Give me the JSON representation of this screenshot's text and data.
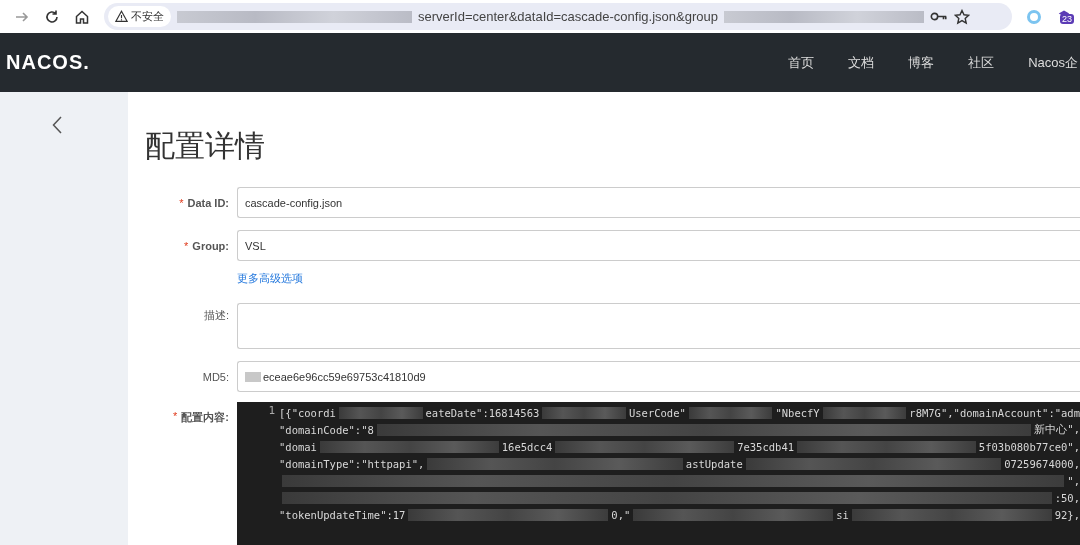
{
  "browser": {
    "security": "不安全",
    "url_parts": [
      {
        "kind": "blur"
      },
      {
        "kind": "text",
        "text": "serverId=center&dataId=cascade-config.json&group"
      },
      {
        "kind": "blur"
      }
    ],
    "badge": "23"
  },
  "header": {
    "logo": "NACOS.",
    "nav": [
      {
        "label": "首页"
      },
      {
        "label": "文档"
      },
      {
        "label": "博客"
      },
      {
        "label": "社区"
      },
      {
        "label": "Nacos企"
      }
    ]
  },
  "page": {
    "title": "配置详情"
  },
  "form": [
    {
      "kind": "input",
      "label": "Data ID:",
      "required_mark": "*",
      "value": "cascade-config.json"
    },
    {
      "kind": "input",
      "label": "Group:",
      "required_mark": "*",
      "value": "VSL"
    },
    {
      "kind": "link",
      "text": "更多高级选项"
    },
    {
      "kind": "textarea",
      "label": "描述:"
    },
    {
      "kind": "input",
      "label": "MD5:",
      "value": "eceae6e96cc59e69753c41810d9",
      "redacted_start": true
    }
  ],
  "content": {
    "label": "配置内容:",
    "required_mark": "*",
    "line_number": "1",
    "lines": [
      [
        {
          "kind": "text",
          "text": "[{\"coordi"
        },
        {
          "kind": "blur"
        },
        {
          "kind": "text",
          "text": "eateDate\":16814563"
        },
        {
          "kind": "blur"
        },
        {
          "kind": "text",
          "text": "UserCode\""
        },
        {
          "kind": "blur"
        },
        {
          "kind": "text",
          "text": "\"NbecfY"
        },
        {
          "kind": "blur"
        },
        {
          "kind": "text",
          "text": "r8M7G\",\"domainAccount\":\"adm"
        }
      ],
      [
        {
          "kind": "text",
          "text": "\"domainCode\":\"8"
        },
        {
          "kind": "blur"
        },
        {
          "kind": "text",
          "text": "新中心\","
        }
      ],
      [
        {
          "kind": "text",
          "text": "\"domai"
        },
        {
          "kind": "blur"
        },
        {
          "kind": "text",
          "text": "16e5dcc4"
        },
        {
          "kind": "blur"
        },
        {
          "kind": "text",
          "text": "7e35cdb41"
        },
        {
          "kind": "blur"
        },
        {
          "kind": "text",
          "text": "5f03b080b77ce0\","
        }
      ],
      [
        {
          "kind": "text",
          "text": "\"domainType\":\"httpapi\","
        },
        {
          "kind": "blur"
        },
        {
          "kind": "text",
          "text": "astUpdate"
        },
        {
          "kind": "blur"
        },
        {
          "kind": "text",
          "text": "07259674000,"
        }
      ],
      [
        {
          "kind": "blur"
        },
        {
          "kind": "text",
          "text": "\","
        }
      ],
      [
        {
          "kind": "blur"
        },
        {
          "kind": "text",
          "text": ":50,"
        }
      ],
      [
        {
          "kind": "text",
          "text": "\"tokenUpdateTime\":17"
        },
        {
          "kind": "blur"
        },
        {
          "kind": "text",
          "text": "0,\""
        },
        {
          "kind": "blur"
        },
        {
          "kind": "text",
          "text": "si"
        },
        {
          "kind": "blur"
        },
        {
          "kind": "text",
          "text": "92},"
        }
      ]
    ]
  }
}
